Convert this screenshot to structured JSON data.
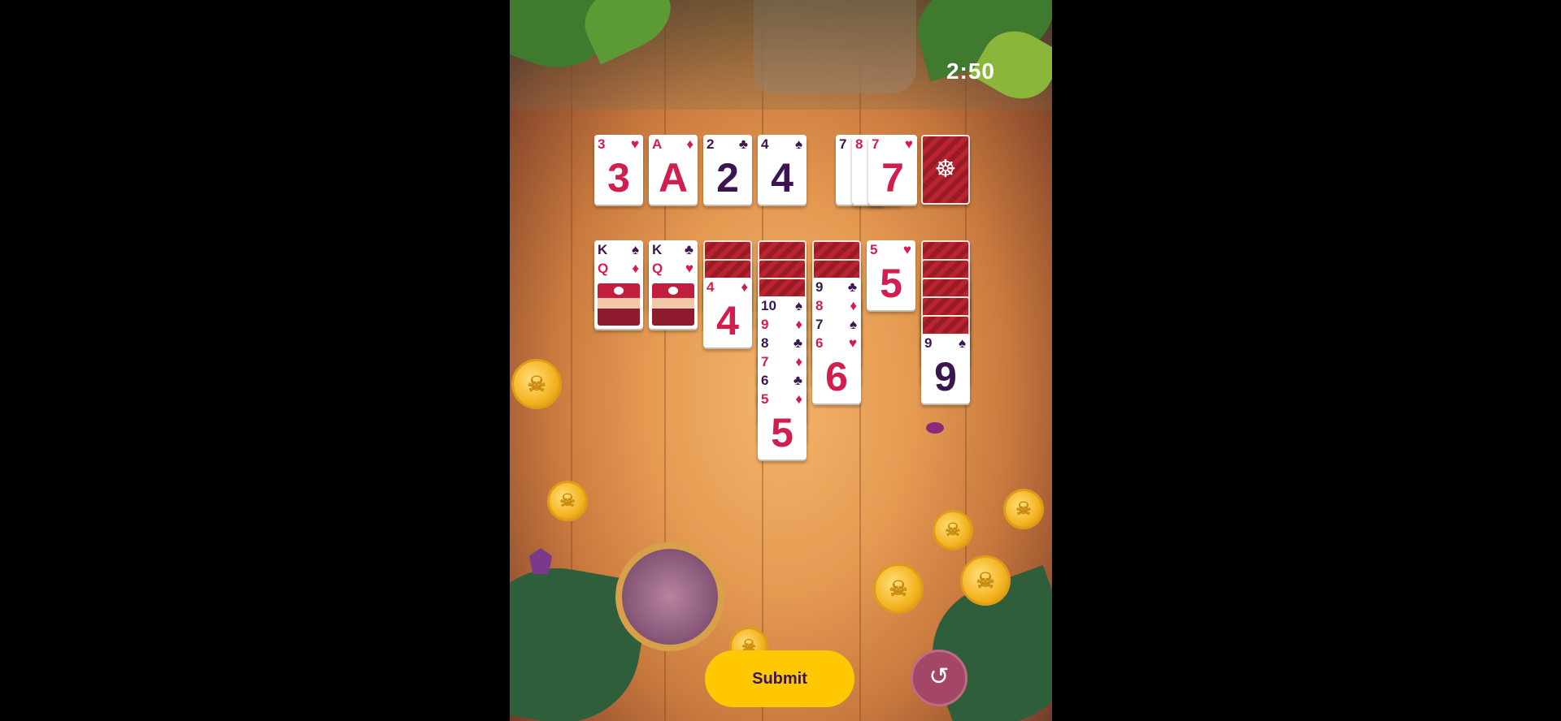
{
  "timer": "2:50",
  "foundations": [
    {
      "rank": "3",
      "suit": "♥",
      "color": "red"
    },
    {
      "rank": "A",
      "suit": "♦",
      "color": "red"
    },
    {
      "rank": "2",
      "suit": "♣",
      "color": "dark"
    },
    {
      "rank": "4",
      "suit": "♠",
      "color": "dark"
    }
  ],
  "waste": [
    {
      "rank": "7",
      "suit": "",
      "color": "dark"
    },
    {
      "rank": "8",
      "suit": "",
      "color": "red"
    },
    {
      "rank": "7",
      "suit": "♥",
      "color": "red"
    }
  ],
  "stock": {
    "icon": "ship-wheel-icon",
    "glyph": "☸"
  },
  "tableau": [
    {
      "hidden": 0,
      "cards": [
        {
          "rank": "K",
          "suit": "♠",
          "color": "dark"
        },
        {
          "rank": "Q",
          "suit": "♦",
          "color": "red",
          "face": true
        }
      ]
    },
    {
      "hidden": 0,
      "cards": [
        {
          "rank": "K",
          "suit": "♣",
          "color": "dark"
        },
        {
          "rank": "Q",
          "suit": "♥",
          "color": "red",
          "face": true
        }
      ]
    },
    {
      "hidden": 2,
      "cards": [
        {
          "rank": "4",
          "suit": "♦",
          "color": "red"
        }
      ]
    },
    {
      "hidden": 3,
      "cards": [
        {
          "rank": "10",
          "suit": "♠",
          "color": "dark"
        },
        {
          "rank": "9",
          "suit": "♦",
          "color": "red"
        },
        {
          "rank": "8",
          "suit": "♣",
          "color": "dark"
        },
        {
          "rank": "7",
          "suit": "♦",
          "color": "red"
        },
        {
          "rank": "6",
          "suit": "♣",
          "color": "dark"
        },
        {
          "rank": "5",
          "suit": "♦",
          "color": "red"
        }
      ]
    },
    {
      "hidden": 2,
      "cards": [
        {
          "rank": "9",
          "suit": "♣",
          "color": "dark"
        },
        {
          "rank": "8",
          "suit": "♦",
          "color": "red"
        },
        {
          "rank": "7",
          "suit": "♠",
          "color": "dark"
        },
        {
          "rank": "6",
          "suit": "♥",
          "color": "red"
        }
      ]
    },
    {
      "hidden": 0,
      "cards": [
        {
          "rank": "5",
          "suit": "♥",
          "color": "red"
        }
      ]
    },
    {
      "hidden": 5,
      "cards": [
        {
          "rank": "9",
          "suit": "♠",
          "color": "dark"
        }
      ]
    }
  ],
  "buttons": {
    "submit": "Submit",
    "undo_icon": "↺"
  },
  "colors": {
    "submit": "#ffc800",
    "undo": "#a44766",
    "red_suit": "#d21e4e",
    "dark_suit": "#3a1550",
    "card_back": "#b8242f"
  }
}
